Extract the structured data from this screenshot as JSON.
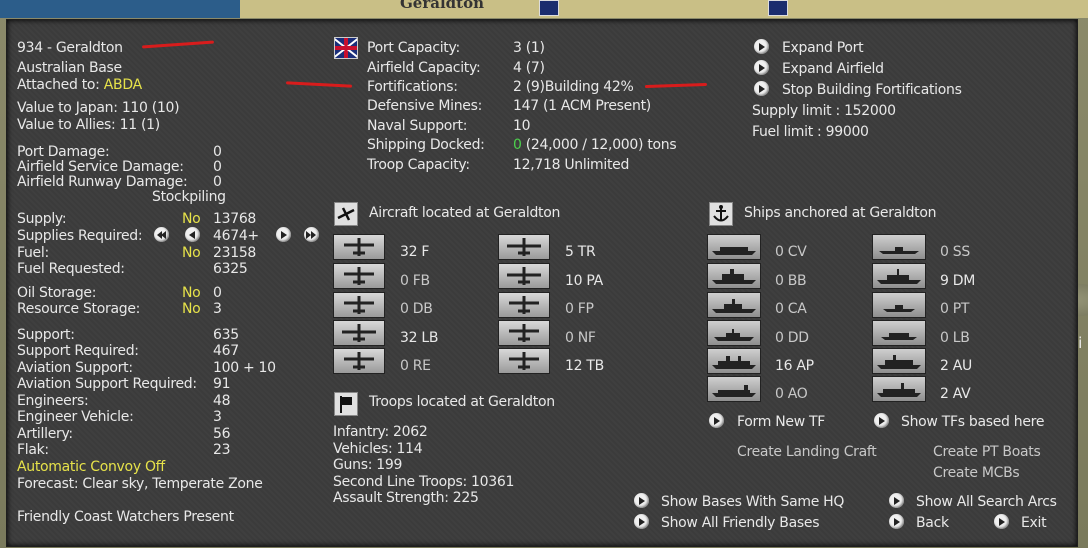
{
  "map": {
    "label": "Geraldton"
  },
  "base": {
    "name": "934 - Geraldton",
    "type": "Australian Base",
    "attached_label": "Attached to:",
    "attached_value": "ABDA",
    "value_japan": "Value to Japan:  110 (10)",
    "value_allies": "Value to Allies:  11 (1)",
    "damage": [
      {
        "label": "Port Damage:",
        "value": "0"
      },
      {
        "label": "Airfield Service Damage:",
        "value": "0"
      },
      {
        "label": "Airfield Runway Damage:",
        "value": "0"
      }
    ],
    "stockpiling_header": "Stockpiling",
    "supply": {
      "label": "Supply:",
      "flag": "No",
      "value": "13768"
    },
    "supplies_required": {
      "label": "Supplies Required:",
      "value": "4674+"
    },
    "fuel": {
      "label": "Fuel:",
      "flag": "No",
      "value": "23158"
    },
    "fuel_requested": {
      "label": "Fuel Requested:",
      "value": "6325"
    },
    "oil_storage": {
      "label": "Oil Storage:",
      "flag": "No",
      "value": "0"
    },
    "resource_storage": {
      "label": "Resource Storage:",
      "flag": "No",
      "value": "3"
    },
    "support_rows": [
      {
        "label": "Support:",
        "value": "635"
      },
      {
        "label": "Support Required:",
        "value": "467"
      },
      {
        "label": "Aviation Support:",
        "value": "100 + 10"
      },
      {
        "label": "Aviation Support Required:",
        "value": "91"
      },
      {
        "label": "Engineers:",
        "value": "48"
      },
      {
        "label": "Engineer Vehicle:",
        "value": "3"
      },
      {
        "label": "Artillery:",
        "value": "56"
      },
      {
        "label": "Flak:",
        "value": "23"
      }
    ],
    "convoy": "Automatic Convoy Off",
    "forecast": "Forecast: Clear sky, Temperate Zone",
    "coast_watchers": "Friendly Coast Watchers Present"
  },
  "facilities": [
    {
      "label": "Port Capacity:",
      "value": "3 (1)"
    },
    {
      "label": "Airfield Capacity:",
      "value": "4 (7)"
    },
    {
      "label": "Fortifications:",
      "value": "2 (9)Building 42%"
    },
    {
      "label": "Defensive Mines:",
      "value": "147 (1 ACM Present)"
    },
    {
      "label": "Naval Support:",
      "value": "10"
    },
    {
      "label": "Shipping Docked:",
      "value_green": "0",
      "value": " (24,000 / 12,000) tons"
    },
    {
      "label": "Troop Capacity:",
      "value": "12,718    Unlimited"
    }
  ],
  "actions": {
    "expand_port": "Expand Port",
    "expand_airfield": "Expand Airfield",
    "stop_fortifications": "Stop Building Fortifications",
    "supply_limit": "Supply limit : 152000",
    "fuel_limit": "Fuel limit : 99000"
  },
  "aircraft": {
    "header": "Aircraft located at Geraldton",
    "left": [
      {
        "label": "32 F",
        "active": true
      },
      {
        "label": "0 FB",
        "active": false
      },
      {
        "label": "0 DB",
        "active": false
      },
      {
        "label": "32 LB",
        "active": true
      },
      {
        "label": "0 RE",
        "active": false
      }
    ],
    "right": [
      {
        "label": "5 TR",
        "active": true
      },
      {
        "label": "10 PA",
        "active": true
      },
      {
        "label": "0 FP",
        "active": false
      },
      {
        "label": "0 NF",
        "active": false
      },
      {
        "label": "12 TB",
        "active": true
      }
    ]
  },
  "ships": {
    "header": "Ships anchored at Geraldton",
    "left": [
      {
        "label": "0 CV",
        "active": false
      },
      {
        "label": "0 BB",
        "active": false
      },
      {
        "label": "0 CA",
        "active": false
      },
      {
        "label": "0 DD",
        "active": false
      },
      {
        "label": "16 AP",
        "active": true
      },
      {
        "label": "0 AO",
        "active": false
      }
    ],
    "right": [
      {
        "label": "0 SS",
        "active": false
      },
      {
        "label": "9 DM",
        "active": true
      },
      {
        "label": "0 PT",
        "active": false
      },
      {
        "label": "0 LB",
        "active": false
      },
      {
        "label": "2 AU",
        "active": true
      },
      {
        "label": "2 AV",
        "active": true
      }
    ],
    "form_new_tf": "Form New TF",
    "show_tfs": "Show TFs based here",
    "create_landing_craft": "Create Landing Craft",
    "create_pt_boats": "Create PT Boats",
    "create_mcbs": "Create MCBs"
  },
  "troops": {
    "header": "Troops located at Geraldton",
    "rows": [
      "Infantry: 2062",
      "Vehicles: 114",
      "Guns: 199",
      "Second Line Troops: 10361",
      "Assault Strength: 225"
    ]
  },
  "footer": {
    "show_bases_same_hq": "Show Bases With Same HQ",
    "show_all_friendly": "Show All Friendly Bases",
    "show_search_arcs": "Show All Search Arcs",
    "back": "Back",
    "exit": "Exit"
  },
  "colors": {
    "highlight": "#e6e24a",
    "green": "#4cd04c",
    "panel": "#3c3c3c",
    "marker": "#d81c1c"
  }
}
